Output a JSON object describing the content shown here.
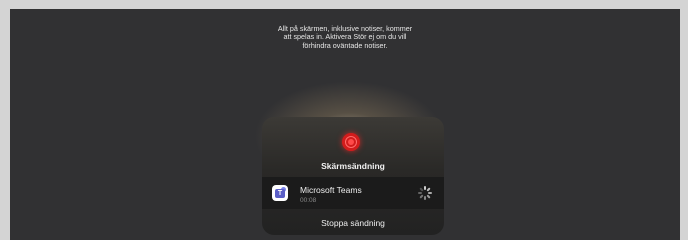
{
  "notice": {
    "line1": "Allt på skärmen, inklusive notiser, kommer",
    "line2": "att spelas in. Aktivera Stör ej om du vill",
    "line3": "förhindra oväntade notiser."
  },
  "panel": {
    "title": "Skärmsändning",
    "app": {
      "name": "Microsoft Teams",
      "elapsed": "00:08",
      "icon": "teams-icon"
    },
    "stop_label": "Stoppa sändning"
  },
  "colors": {
    "record_red": "#d21c1c",
    "teams_purple": "#5b5fc7"
  }
}
